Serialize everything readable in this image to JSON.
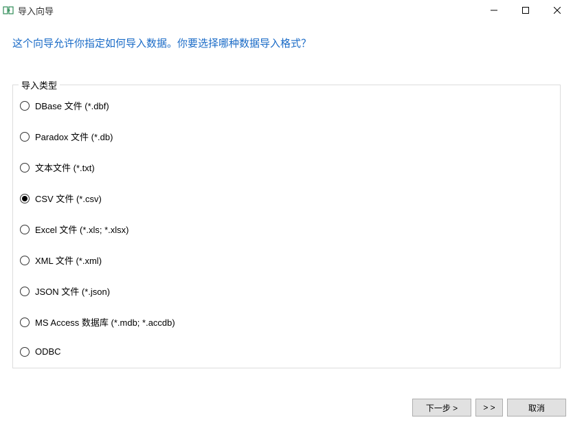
{
  "window": {
    "title": "导入向导"
  },
  "instruction": "这个向导允许你指定如何导入数据。你要选择哪种数据导入格式？",
  "group": {
    "legend": "导入类型",
    "options": [
      {
        "label": "DBase 文件 (*.dbf)",
        "selected": false
      },
      {
        "label": "Paradox 文件 (*.db)",
        "selected": false
      },
      {
        "label": "文本文件 (*.txt)",
        "selected": false
      },
      {
        "label": "CSV 文件 (*.csv)",
        "selected": true
      },
      {
        "label": "Excel 文件 (*.xls; *.xlsx)",
        "selected": false
      },
      {
        "label": "XML 文件 (*.xml)",
        "selected": false
      },
      {
        "label": "JSON 文件 (*.json)",
        "selected": false
      },
      {
        "label": "MS Access 数据库 (*.mdb; *.accdb)",
        "selected": false
      },
      {
        "label": "ODBC",
        "selected": false
      }
    ]
  },
  "footer": {
    "next": "下一步 >",
    "skip": "> >",
    "cancel": "取消"
  }
}
